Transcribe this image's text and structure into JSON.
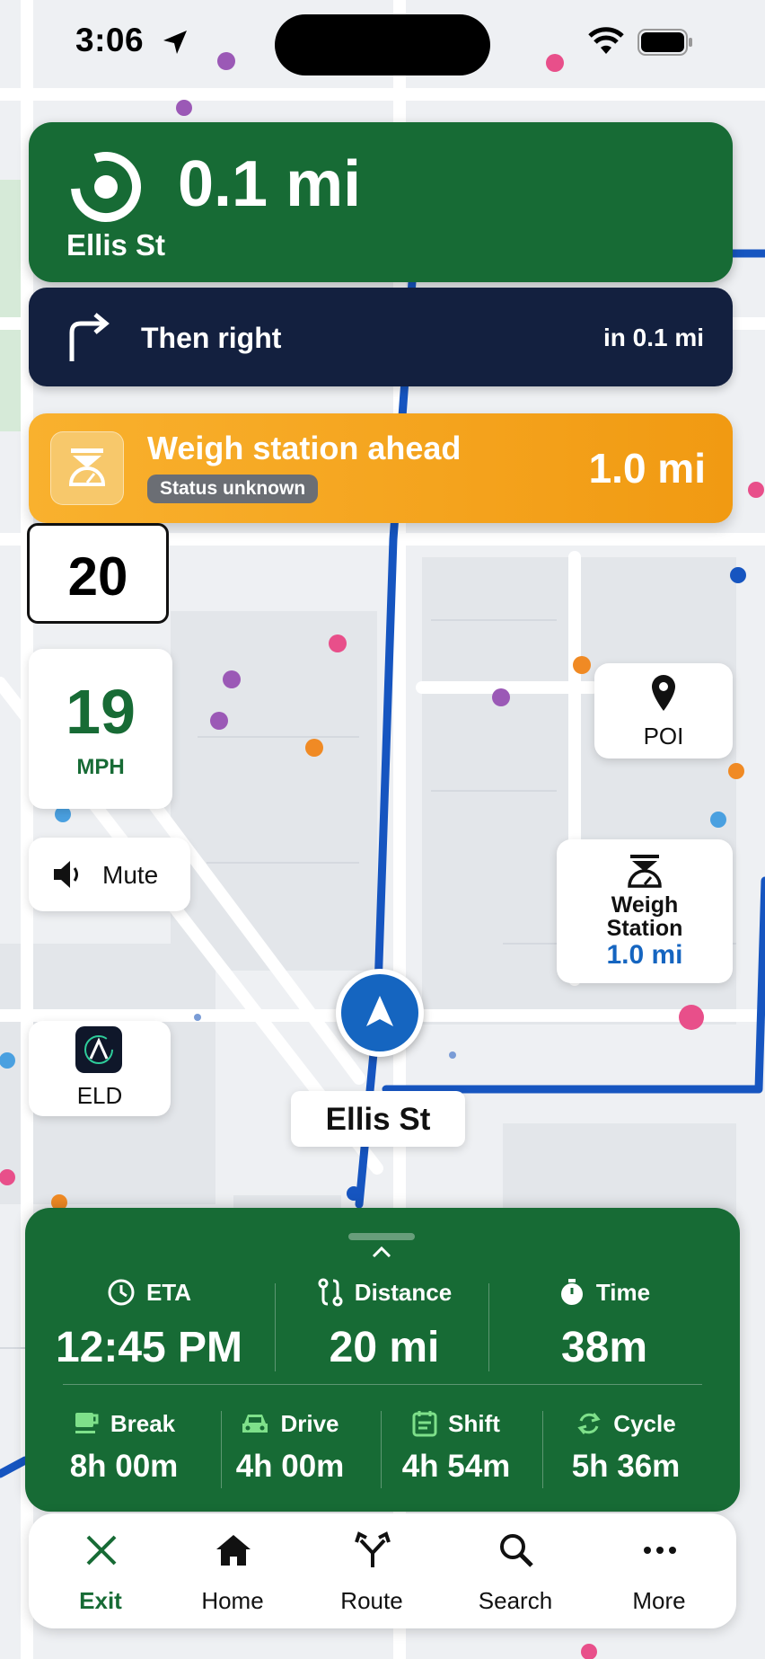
{
  "status_bar": {
    "time": "3:06"
  },
  "maneuver": {
    "distance": "0.1 mi",
    "street": "Ellis St"
  },
  "next_turn": {
    "label": "Then right",
    "distance": "in 0.1 mi"
  },
  "weigh_alert": {
    "title": "Weigh station ahead",
    "status": "Status unknown",
    "distance": "1.0 mi"
  },
  "speed_limit": "20",
  "current_speed": {
    "value": "19",
    "unit": "MPH"
  },
  "mute": {
    "label": "Mute"
  },
  "eld": {
    "label": "ELD"
  },
  "poi": {
    "label": "POI"
  },
  "weigh_card": {
    "line1": "Weigh",
    "line2": "Station",
    "distance": "1.0 mi"
  },
  "current_street": "Ellis St",
  "trip": {
    "eta": {
      "label": "ETA",
      "value": "12:45 PM"
    },
    "distance": {
      "label": "Distance",
      "value": "20 mi"
    },
    "time": {
      "label": "Time",
      "value": "38m"
    },
    "break": {
      "label": "Break",
      "value": "8h 00m"
    },
    "drive": {
      "label": "Drive",
      "value": "4h 00m"
    },
    "shift": {
      "label": "Shift",
      "value": "4h 54m"
    },
    "cycle": {
      "label": "Cycle",
      "value": "5h 36m"
    }
  },
  "tabs": [
    {
      "label": "Exit",
      "icon": "close-icon"
    },
    {
      "label": "Home",
      "icon": "home-icon"
    },
    {
      "label": "Route",
      "icon": "route-fork-icon"
    },
    {
      "label": "Search",
      "icon": "search-icon"
    },
    {
      "label": "More",
      "icon": "more-icon"
    }
  ],
  "colors": {
    "green": "#176b35",
    "navy": "#13203f",
    "orange": "#f5a623",
    "route_blue": "#1655c0"
  }
}
